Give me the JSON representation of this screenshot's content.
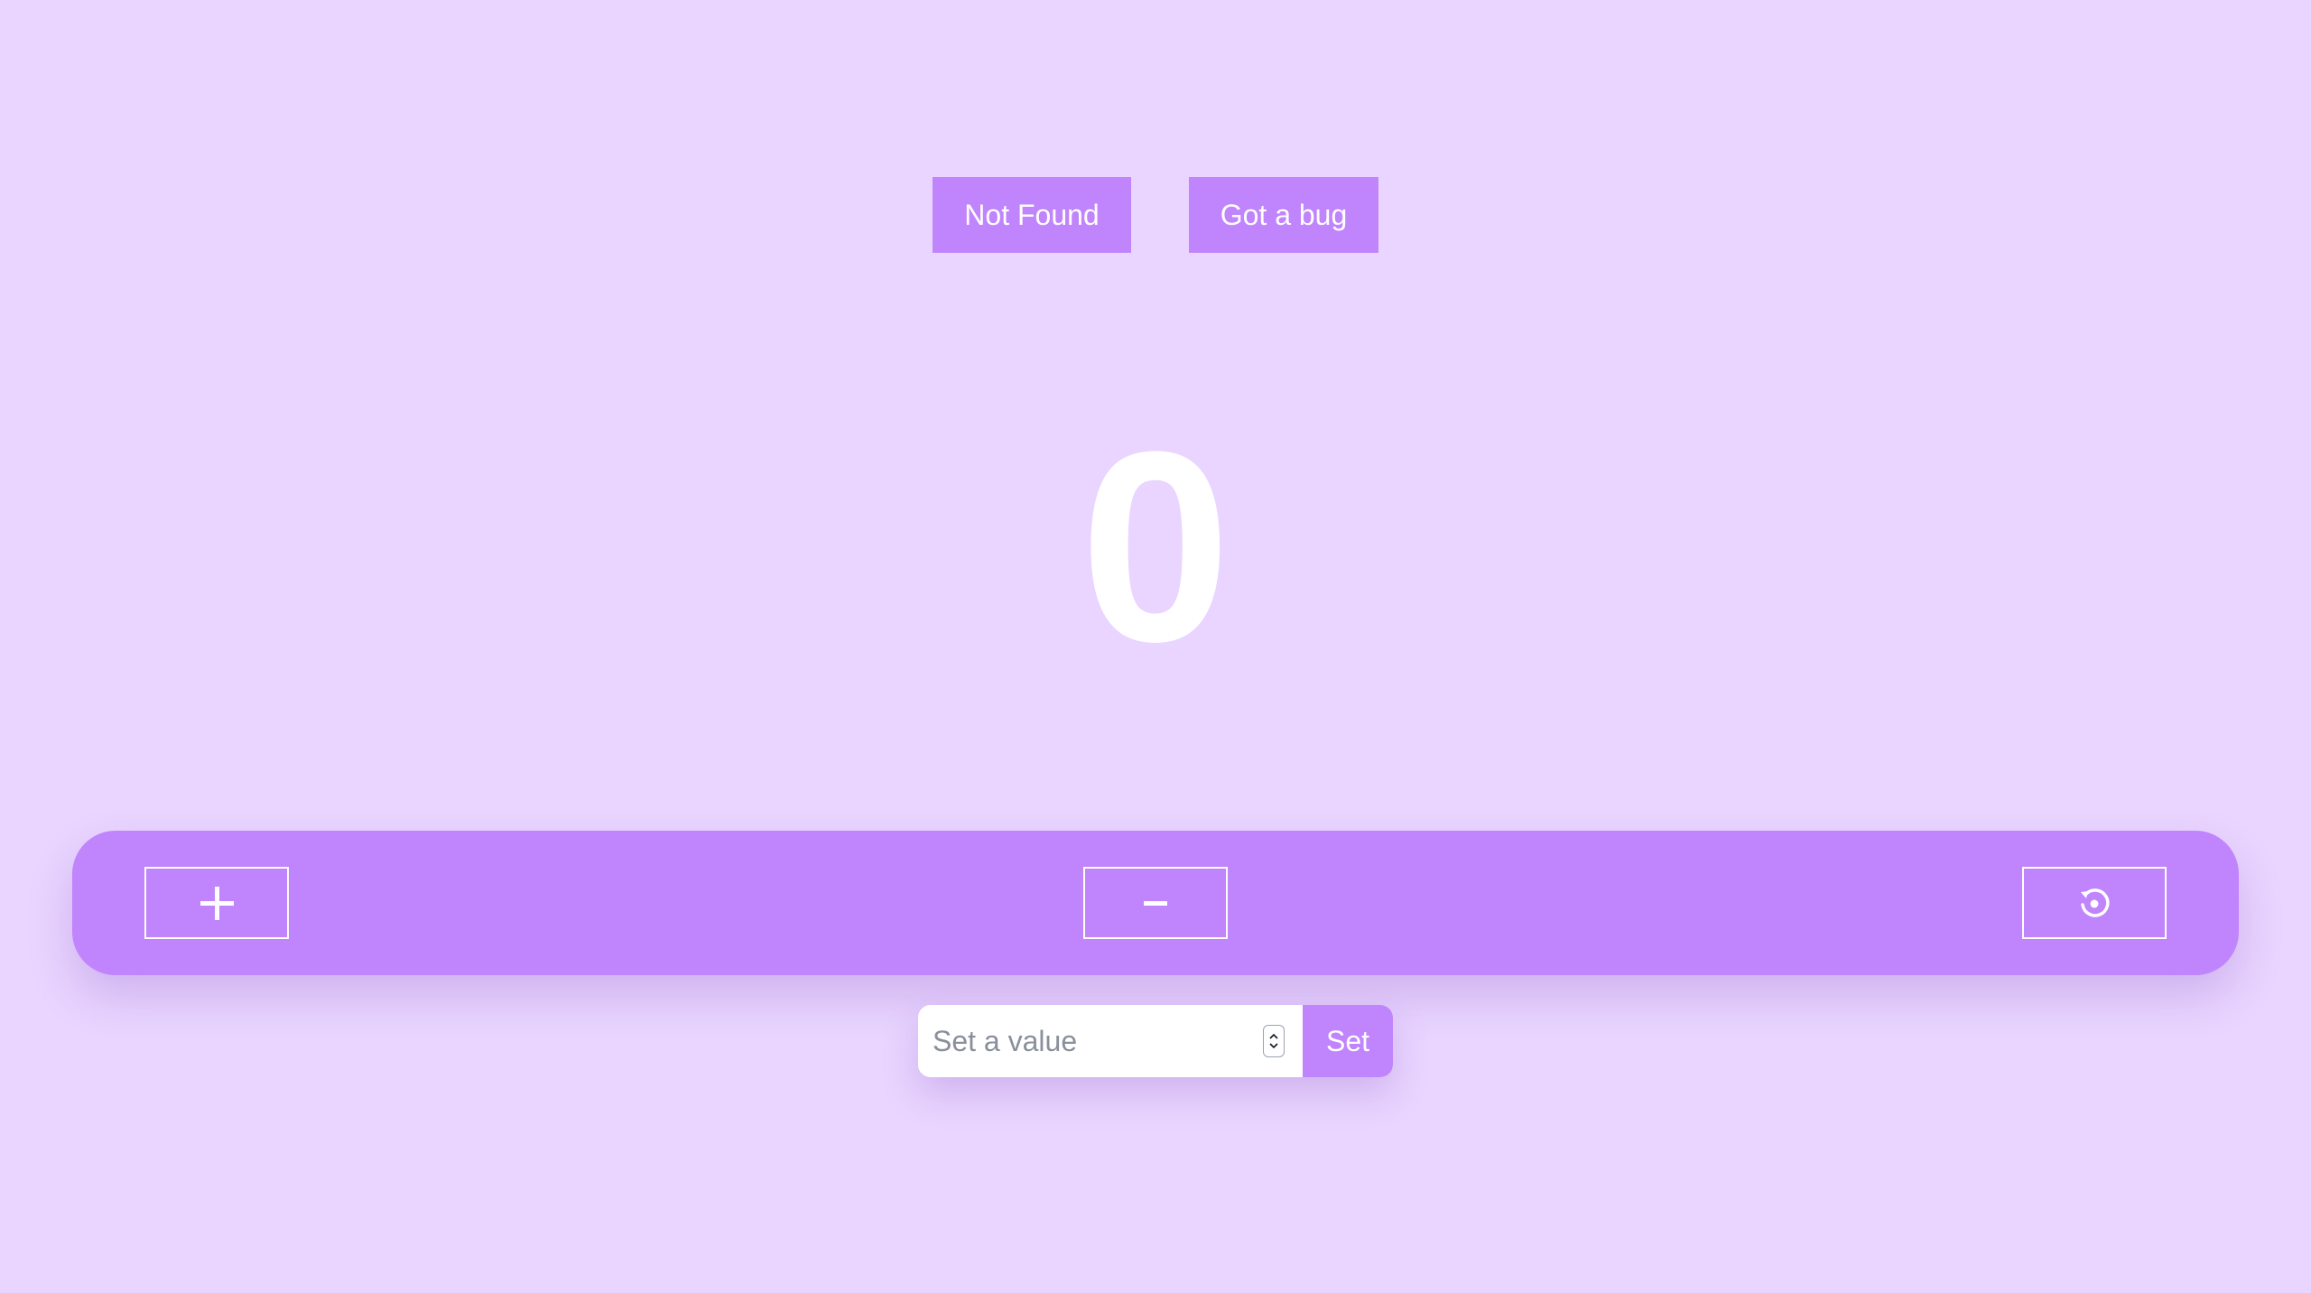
{
  "nav": {
    "links": [
      {
        "label": "Not Found"
      },
      {
        "label": "Got a bug"
      }
    ]
  },
  "counter": {
    "value": "0"
  },
  "controls": {
    "increment_icon": "plus-icon",
    "decrement_label": "-",
    "reset_icon": "reset-icon"
  },
  "set_form": {
    "placeholder": "Set a value",
    "value": "",
    "button_label": "Set"
  },
  "colors": {
    "background": "#e9d5ff",
    "accent": "#c084fc",
    "text_light": "#ffffff"
  }
}
